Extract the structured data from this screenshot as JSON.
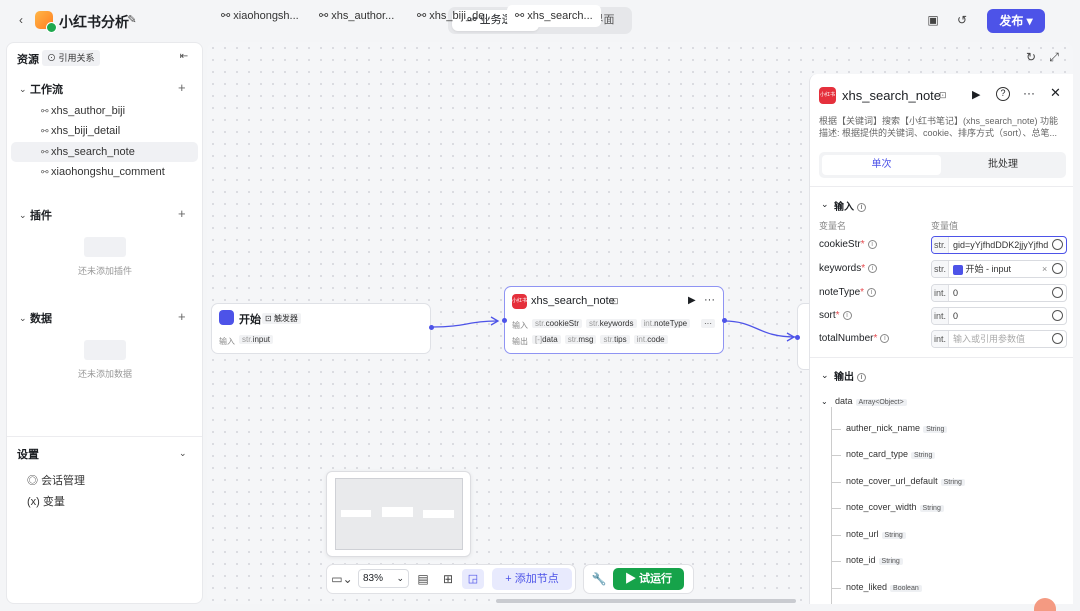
{
  "header": {
    "back_icon": "chevron-left-icon",
    "title": "小红书分析",
    "edit_icon": "edit-icon",
    "tab_logic": "业务逻辑",
    "tab_ui": "用户界面",
    "publish": "发布",
    "icons": [
      "monitor-icon",
      "history-icon"
    ]
  },
  "sidebar": {
    "resources": "资源",
    "ref_btn": "引用关系",
    "workflow_title": "工作流",
    "workflows": [
      "xhs_author_biji",
      "xhs_biji_detail",
      "xhs_search_note",
      "xiaohongshu_comment"
    ],
    "plugin_title": "插件",
    "plugin_empty": "还未添加插件",
    "data_title": "数据",
    "data_empty": "还未添加数据",
    "settings_title": "设置",
    "settings_items": [
      "会话管理",
      "变量"
    ]
  },
  "tabs": [
    "xiaohongsh...",
    "xhs_author...",
    "xhs_biji_de...",
    "xhs_search..."
  ],
  "start_node": {
    "title": "开始",
    "badge": "触发器",
    "in_label": "输入",
    "in_chip": "input",
    "in_type": "str."
  },
  "search_node": {
    "title": "xhs_search_note",
    "in_label": "输入",
    "inputs": [
      {
        "t": "str.",
        "n": "cookieStr"
      },
      {
        "t": "str.",
        "n": "keywords"
      },
      {
        "t": "int.",
        "n": "noteType"
      }
    ],
    "out_label": "输出",
    "outputs": [
      {
        "t": "[-]",
        "n": "data"
      },
      {
        "t": "str.",
        "n": "msg"
      },
      {
        "t": "str.",
        "n": "tips"
      },
      {
        "t": "int.",
        "n": "code"
      }
    ]
  },
  "bottom": {
    "zoom": "83%",
    "add_node": "添加节点",
    "run": "试运行"
  },
  "panel": {
    "title": "xhs_search_note",
    "desc1": "根据【关键词】搜索【小红书笔记】(xhs_search_note) 功能",
    "desc2": "描述: 根据提供的关键词、cookie、排序方式（sort）、总笔...",
    "tab_single": "单次",
    "tab_batch": "批处理",
    "input_title": "输入",
    "col_name": "变量名",
    "col_value": "变量值",
    "params": [
      {
        "name": "cookieStr",
        "req": true,
        "type": "str.",
        "value": "gid=yYjfhdDDK2jjyYjfhd"
      },
      {
        "name": "keywords",
        "req": true,
        "type": "str.",
        "value": "开始 - input"
      },
      {
        "name": "noteType",
        "req": true,
        "type": "int.",
        "value": "0"
      },
      {
        "name": "sort",
        "req": true,
        "type": "int.",
        "value": "0"
      },
      {
        "name": "totalNumber",
        "req": true,
        "type": "int.",
        "value": "输入或引用参数值"
      }
    ],
    "output_title": "输出",
    "data_name": "data",
    "data_type": "Array<Object>",
    "outputs": [
      {
        "n": "auther_nick_name",
        "t": "String"
      },
      {
        "n": "note_card_type",
        "t": "String"
      },
      {
        "n": "note_cover_url_default",
        "t": "String"
      },
      {
        "n": "note_cover_width",
        "t": "String"
      },
      {
        "n": "note_url",
        "t": "String"
      },
      {
        "n": "note_id",
        "t": "String"
      },
      {
        "n": "note_liked",
        "t": "Boolean"
      }
    ]
  }
}
